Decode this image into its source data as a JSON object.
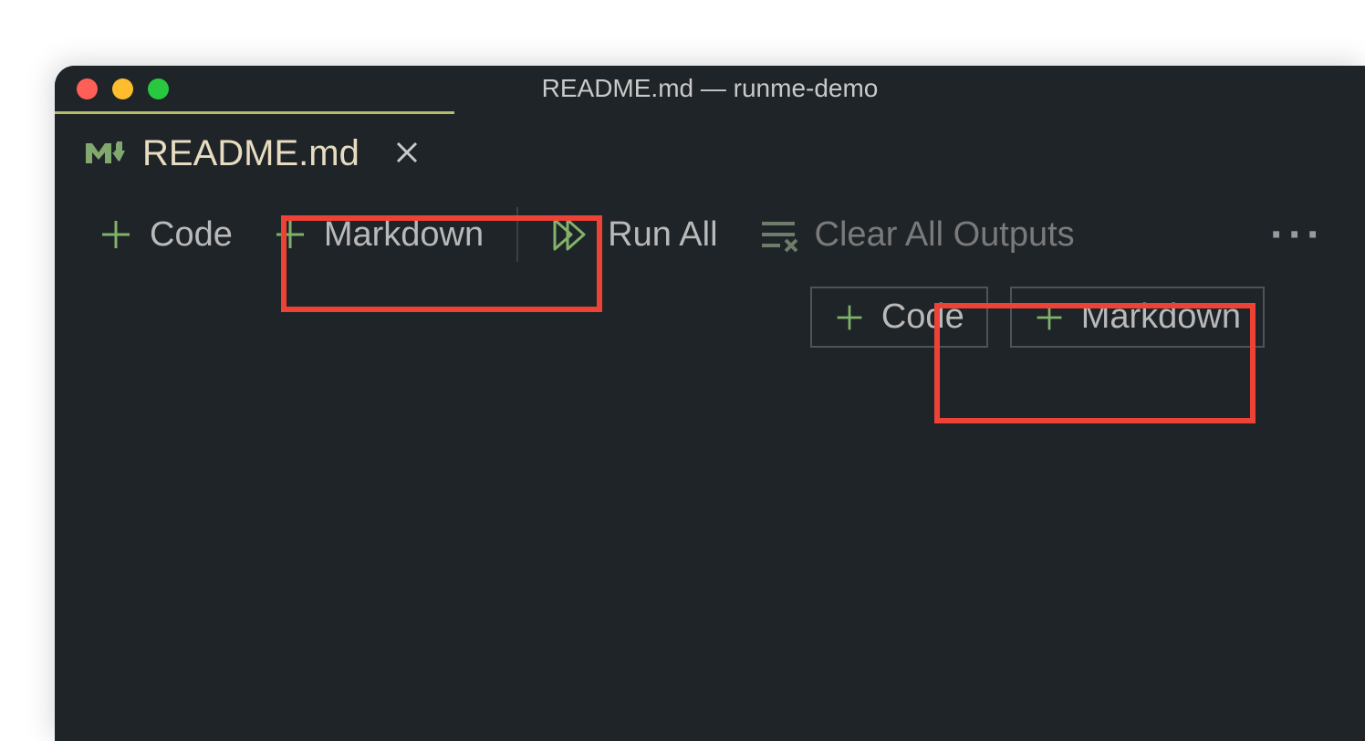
{
  "titlebar": {
    "title": "README.md — runme-demo"
  },
  "tab": {
    "label": "README.md"
  },
  "toolbar": {
    "code": "Code",
    "markdown": "Markdown",
    "run_all": "Run All",
    "clear_all": "Clear All Outputs"
  },
  "addcell": {
    "code": "Code",
    "markdown": "Markdown"
  },
  "colors": {
    "accent": "#81b26a",
    "highlight": "#ef4236"
  }
}
